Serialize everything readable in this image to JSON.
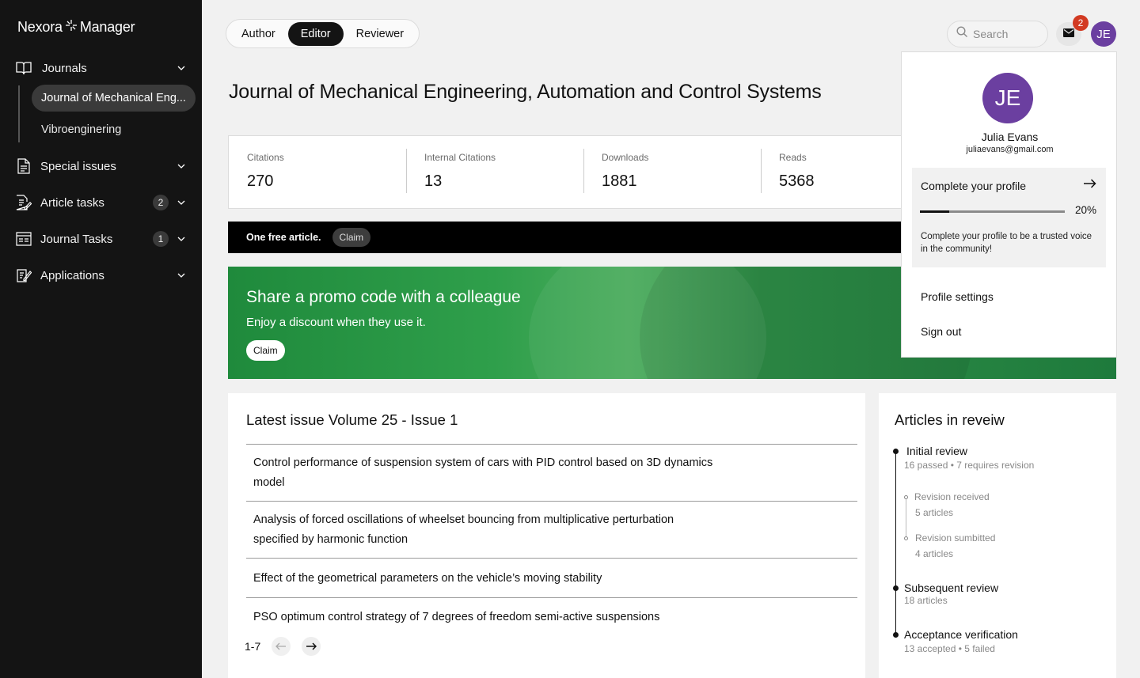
{
  "brand": {
    "name_left": "Nexora",
    "name_right": "Manager",
    "icon": "spark-icon"
  },
  "sidebar": {
    "items": [
      {
        "label": "Journals",
        "icon": "book-icon"
      },
      {
        "label": "Special issues",
        "icon": "document-icon"
      },
      {
        "label": "Article tasks",
        "icon": "edit-document-icon",
        "count": "2"
      },
      {
        "label": "Journal Tasks",
        "icon": "task-board-icon",
        "count": "1"
      },
      {
        "label": "Applications",
        "icon": "form-edit-icon"
      }
    ],
    "journals": [
      {
        "label": "Journal of Mechanical Engineering, Automation and Control Systems",
        "display": "Journal of Mechanical Eng...",
        "active": true
      },
      {
        "label": "Vibroenginering",
        "display": "Vibroenginering",
        "active": false
      }
    ]
  },
  "roles": {
    "tabs": [
      "Author",
      "Editor",
      "Reviewer"
    ],
    "active": "Editor"
  },
  "search": {
    "placeholder": "Search",
    "value": ""
  },
  "notifications": {
    "count": "2"
  },
  "user": {
    "initials": "JE",
    "name": "Julia Evans",
    "email": "juliaevans@gmail.com",
    "avatar_color": "#6b3fa0"
  },
  "page": {
    "title": "Journal of Mechanical Engineering, Automation and Control Systems"
  },
  "stats": [
    {
      "label": "Citations",
      "value": "270"
    },
    {
      "label": "Internal Citations",
      "value": "13"
    },
    {
      "label": "Downloads",
      "value": "1881"
    },
    {
      "label": "Reads",
      "value": "5368"
    }
  ],
  "free_bar": {
    "text": "One free article.",
    "button": "Claim"
  },
  "promo": {
    "title": "Share a promo code with a colleague",
    "subtitle": "Enjoy a discount when they use it.",
    "button": "Claim"
  },
  "issue": {
    "title": "Latest issue Volume 25 - Issue 1",
    "articles": [
      "Control performance of suspension system of cars with PID control based on 3D dynamics model",
      "Analysis of forced oscillations of wheelset bouncing from multiplicative perturbation specified by harmonic function",
      "Effect of the geometrical parameters on the vehicle’s moving stability",
      "PSO optimum control strategy of 7 degrees of freedom semi-active suspensions"
    ],
    "range": "1-7"
  },
  "review": {
    "title": "Articles in reveiw",
    "initial": {
      "label": "Initial review",
      "sub": "16 passed • 7 requires revision"
    },
    "revision_received": {
      "label": "Revision received",
      "sub": "5 articles"
    },
    "revision_submitted": {
      "label": "Revision sumbitted",
      "sub": "4 articles"
    },
    "subsequent": {
      "label": "Subsequent review",
      "sub": "18 articles"
    },
    "acceptance": {
      "label": "Acceptance verification",
      "sub": "13 accepted • 5 failed"
    }
  },
  "profile_menu": {
    "complete_title": "Complete your profile",
    "progress_percent": 20,
    "progress_label": "20%",
    "complete_desc": "Complete your profile to be a trusted voice in the community!",
    "settings": "Profile settings",
    "signout": "Sign out"
  },
  "colors": {
    "accent_green": "#2f9f4b",
    "badge_red": "#d23a22",
    "sidebar_bg": "#141414"
  }
}
